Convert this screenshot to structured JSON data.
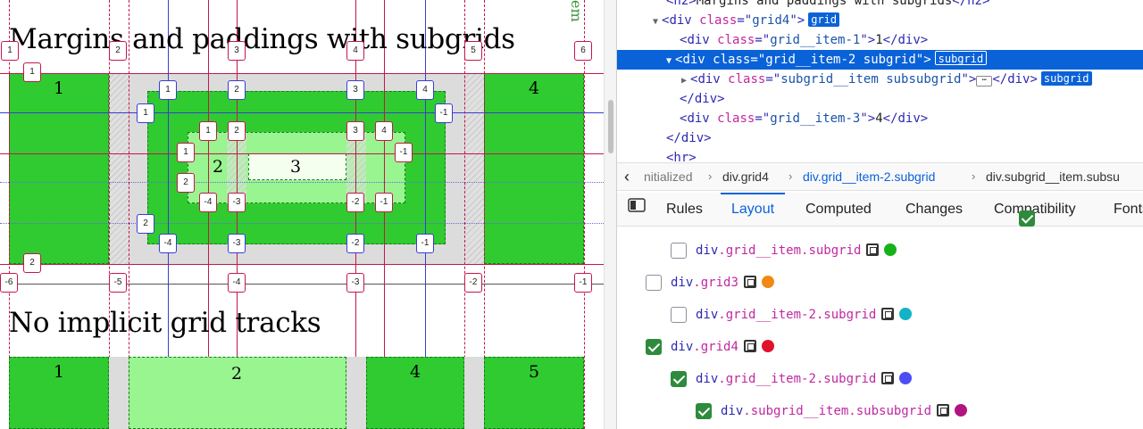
{
  "page": {
    "heading1": "Margins and paddings with subgrids",
    "heading2": "No implicit grid tracks",
    "side_text": "em",
    "grid1_numbers": [
      "1",
      "4",
      "2",
      "3"
    ],
    "grid2_numbers": [
      "1",
      "2",
      "4",
      "5"
    ],
    "line_badges_top": [
      "1",
      "2",
      "3",
      "4",
      "5",
      "6"
    ],
    "line_badges_bottom": [
      "-6",
      "-5",
      "-4",
      "-3",
      "-2",
      "-1"
    ],
    "row_badges": [
      "1",
      "2"
    ],
    "sub1_badges_top": [
      "1",
      "2",
      "3",
      "4"
    ],
    "sub1_badges_bottom": [
      "-4",
      "-3",
      "-2",
      "-1"
    ],
    "sub1_row_badges": [
      "1",
      "-1",
      "2"
    ],
    "sub2_badges_top": [
      "1",
      "2",
      "3",
      "4"
    ],
    "sub2_badges_bottom": [
      "-4",
      "-3",
      "-2",
      "-1"
    ],
    "sub2_row_badges": [
      "1",
      "-1",
      "2"
    ]
  },
  "markup": {
    "lines": [
      {
        "pre": "<h2>",
        "text": "Margins and paddings with subgrids",
        "post": "</h2>"
      },
      {
        "tag": "div",
        "attr": "class",
        "val": "grid4",
        "badge": "grid"
      },
      {
        "tag": "div",
        "attr": "class",
        "val": "grid__item-1",
        "content": "1"
      },
      {
        "tag": "div",
        "attr": "class",
        "val": "grid__item-2 subgrid",
        "badge": "subgrid"
      },
      {
        "tag": "div",
        "attr": "class",
        "val": "subgrid__item subsubgrid",
        "badge": "subgrid",
        "collapsed": "⋯"
      },
      {
        "close": "</div>"
      },
      {
        "tag": "div",
        "attr": "class",
        "val": "grid__item-3",
        "content": "4"
      },
      {
        "close": "</div>"
      },
      {
        "partial": "<hr>"
      }
    ]
  },
  "breadcrumbs": {
    "items": [
      "nitialized",
      "div.grid4",
      "div.grid__item-2.subgrid",
      "div.subgrid__item.subsu"
    ],
    "back_icon": "chevron-left-icon"
  },
  "tabs": {
    "items": [
      "Rules",
      "Layout",
      "Computed",
      "Changes",
      "Compatibility",
      "Fonts"
    ],
    "active": "Layout"
  },
  "layout_panel": {
    "grids": [
      {
        "tag": "div",
        "cls": ".grid__item.subgrid",
        "checked": false,
        "color": "#17b21a",
        "indent": 1
      },
      {
        "tag": "div",
        "cls": ".grid3",
        "checked": false,
        "color": "#f08a15",
        "indent": 0
      },
      {
        "tag": "div",
        "cls": ".grid__item-2.subgrid",
        "checked": false,
        "color": "#12b3c7",
        "indent": 1
      },
      {
        "tag": "div",
        "cls": ".grid4",
        "checked": true,
        "color": "#e0122b",
        "indent": 0
      },
      {
        "tag": "div",
        "cls": ".grid__item-2.subgrid",
        "checked": true,
        "color": "#4d4df5",
        "indent": 1
      },
      {
        "tag": "div",
        "cls": ".subgrid__item.subsubgrid",
        "checked": true,
        "color": "#b3137f",
        "indent": 2
      }
    ]
  },
  "colors": {
    "selection": "#0a62d9",
    "grid_green": "#2fcb31",
    "light_green": "#98f58f",
    "grid_line": "#c3184a",
    "subgrid_line": "#3b3bd6"
  }
}
